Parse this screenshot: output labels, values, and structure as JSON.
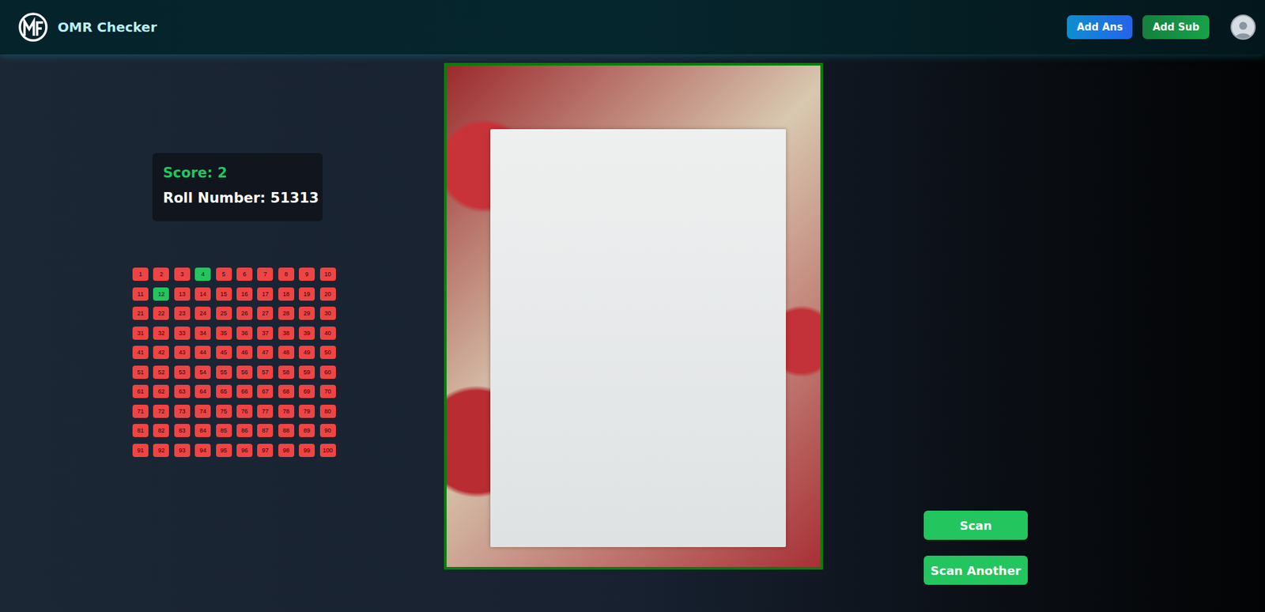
{
  "header": {
    "title": "OMR Checker",
    "buttons": [
      {
        "label": "Add Ans",
        "kind": "primary"
      },
      {
        "label": "Add Sub",
        "kind": "success"
      }
    ]
  },
  "result": {
    "score": "Score: 2",
    "roll_number": "Roll Number: 51313"
  },
  "answers": [
    {
      "label": "1",
      "correct": false
    },
    {
      "label": "2",
      "correct": false
    },
    {
      "label": "3",
      "correct": false
    },
    {
      "label": "4",
      "correct": true
    },
    {
      "label": "5",
      "correct": false
    },
    {
      "label": "6",
      "correct": false
    },
    {
      "label": "7",
      "correct": false
    },
    {
      "label": "8",
      "correct": false
    },
    {
      "label": "9",
      "correct": false
    },
    {
      "label": "10",
      "correct": false
    },
    {
      "label": "11",
      "correct": false
    },
    {
      "label": "12",
      "correct": true
    },
    {
      "label": "13",
      "correct": false
    },
    {
      "label": "14",
      "correct": false
    },
    {
      "label": "15",
      "correct": false
    },
    {
      "label": "16",
      "correct": false
    },
    {
      "label": "17",
      "correct": false
    },
    {
      "label": "18",
      "correct": false
    },
    {
      "label": "19",
      "correct": false
    },
    {
      "label": "20",
      "correct": false
    },
    {
      "label": "21",
      "correct": false
    },
    {
      "label": "22",
      "correct": false
    },
    {
      "label": "23",
      "correct": false
    },
    {
      "label": "24",
      "correct": false
    },
    {
      "label": "25",
      "correct": false
    },
    {
      "label": "26",
      "correct": false
    },
    {
      "label": "27",
      "correct": false
    },
    {
      "label": "28",
      "correct": false
    },
    {
      "label": "29",
      "correct": false
    },
    {
      "label": "30",
      "correct": false
    },
    {
      "label": "31",
      "correct": false
    },
    {
      "label": "32",
      "correct": false
    },
    {
      "label": "33",
      "correct": false
    },
    {
      "label": "34",
      "correct": false
    },
    {
      "label": "35",
      "correct": false
    },
    {
      "label": "36",
      "correct": false
    },
    {
      "label": "37",
      "correct": false
    },
    {
      "label": "38",
      "correct": false
    },
    {
      "label": "39",
      "correct": false
    },
    {
      "label": "40",
      "correct": false
    },
    {
      "label": "41",
      "correct": false
    },
    {
      "label": "42",
      "correct": false
    },
    {
      "label": "43",
      "correct": false
    },
    {
      "label": "44",
      "correct": false
    },
    {
      "label": "45",
      "correct": false
    },
    {
      "label": "46",
      "correct": false
    },
    {
      "label": "47",
      "correct": false
    },
    {
      "label": "48",
      "correct": false
    },
    {
      "label": "49",
      "correct": false
    },
    {
      "label": "50",
      "correct": false
    },
    {
      "label": "51",
      "correct": false
    },
    {
      "label": "52",
      "correct": false
    },
    {
      "label": "53",
      "correct": false
    },
    {
      "label": "54",
      "correct": false
    },
    {
      "label": "55",
      "correct": false
    },
    {
      "label": "56",
      "correct": false
    },
    {
      "label": "57",
      "correct": false
    },
    {
      "label": "58",
      "correct": false
    },
    {
      "label": "59",
      "correct": false
    },
    {
      "label": "60",
      "correct": false
    },
    {
      "label": "61",
      "correct": false
    },
    {
      "label": "62",
      "correct": false
    },
    {
      "label": "63",
      "correct": false
    },
    {
      "label": "64",
      "correct": false
    },
    {
      "label": "65",
      "correct": false
    },
    {
      "label": "66",
      "correct": false
    },
    {
      "label": "67",
      "correct": false
    },
    {
      "label": "68",
      "correct": false
    },
    {
      "label": "69",
      "correct": false
    },
    {
      "label": "70",
      "correct": false
    },
    {
      "label": "71",
      "correct": false
    },
    {
      "label": "72",
      "correct": false
    },
    {
      "label": "73",
      "correct": false
    },
    {
      "label": "74",
      "correct": false
    },
    {
      "label": "75",
      "correct": false
    },
    {
      "label": "76",
      "correct": false
    },
    {
      "label": "77",
      "correct": false
    },
    {
      "label": "78",
      "correct": false
    },
    {
      "label": "79",
      "correct": false
    },
    {
      "label": "80",
      "correct": false
    },
    {
      "label": "81",
      "correct": false
    },
    {
      "label": "82",
      "correct": false
    },
    {
      "label": "83",
      "correct": false
    },
    {
      "label": "84",
      "correct": false
    },
    {
      "label": "85",
      "correct": false
    },
    {
      "label": "86",
      "correct": false
    },
    {
      "label": "87",
      "correct": false
    },
    {
      "label": "88",
      "correct": false
    },
    {
      "label": "89",
      "correct": false
    },
    {
      "label": "90",
      "correct": false
    },
    {
      "label": "91",
      "correct": false
    },
    {
      "label": "92",
      "correct": false
    },
    {
      "label": "93",
      "correct": false
    },
    {
      "label": "94",
      "correct": false
    },
    {
      "label": "95",
      "correct": false
    },
    {
      "label": "96",
      "correct": false
    },
    {
      "label": "97",
      "correct": false
    },
    {
      "label": "98",
      "correct": false
    },
    {
      "label": "99",
      "correct": false
    },
    {
      "label": "100",
      "correct": false
    }
  ],
  "actions": [
    "Scan",
    "Scan Another"
  ]
}
